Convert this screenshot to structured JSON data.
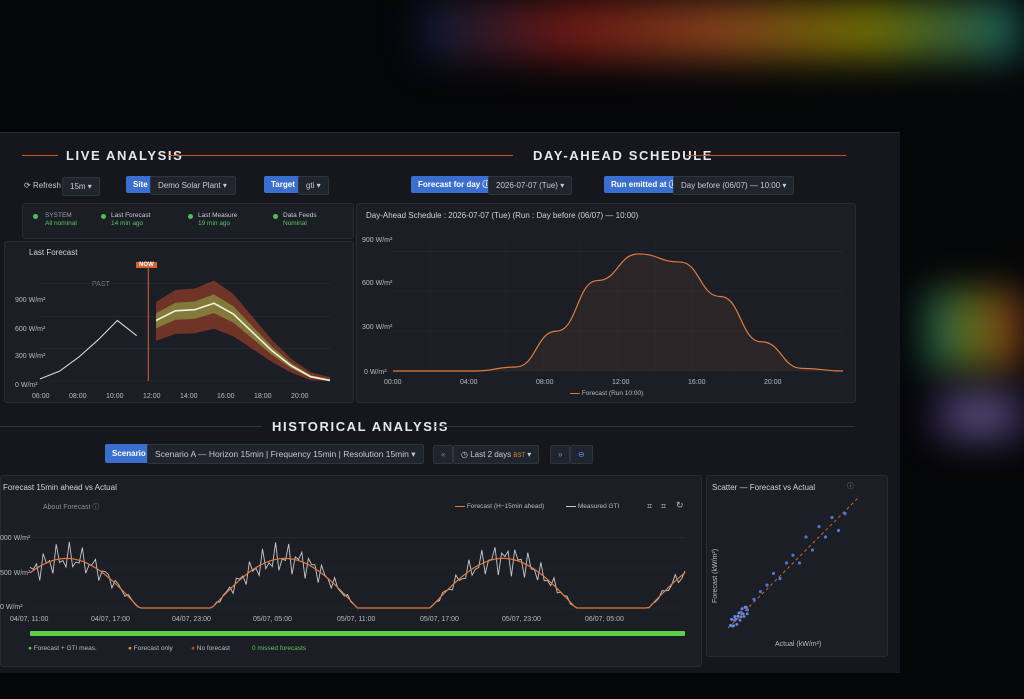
{
  "sections": {
    "live": "LIVE ANALYSIS",
    "dayahead": "DAY-AHEAD SCHEDULE",
    "historical": "HISTORICAL ANALYSIS"
  },
  "toolbar": {
    "refresh_label": "Refresh",
    "refresh_value": "15m",
    "site_label": "Site",
    "site_value": "Demo Solar Plant",
    "target_label": "Target",
    "target_value": "gti",
    "forecast_day_label": "Forecast for day",
    "forecast_day_value": "2026-07-07 (Tue)",
    "run_label": "Run emitted at",
    "run_value": "Day before (06/07) — 10:00"
  },
  "status": {
    "system_label": "SYSTEM",
    "system_value": "All nominal",
    "last_forecast_label": "Last Forecast",
    "last_forecast_value": "14 min ago",
    "last_measure_label": "Last Measure",
    "last_measure_value": "19 min ago",
    "feeds_label": "Data Feeds",
    "feeds_value": "Nominal"
  },
  "live_chart": {
    "title": "Last Forecast",
    "past_label": "PAST",
    "now_label": "NOW",
    "y_ticks": [
      "900 W/m²",
      "600 W/m²",
      "300 W/m²",
      "0 W/m²"
    ],
    "x_ticks": [
      "06:00",
      "08:00",
      "10:00",
      "12:00",
      "14:00",
      "16:00",
      "18:00",
      "20:00"
    ]
  },
  "dayahead_chart": {
    "title": "Day-Ahead Schedule : 2026-07-07 (Tue) (Run : Day before (06/07) — 10:00)",
    "y_ticks": [
      "900 W/m²",
      "600 W/m²",
      "300 W/m²",
      "0 W/m²"
    ],
    "x_ticks": [
      "00:00",
      "04:00",
      "08:00",
      "12:00",
      "16:00",
      "20:00"
    ],
    "legend": "Forecast (Run 10:00)"
  },
  "historical": {
    "scenario_label": "Scenario",
    "scenario_value": "Scenario A — Horizon 15min | Frequency 15min | Resolution 15min",
    "range_value": "Last 2 days",
    "tz": "BST"
  },
  "hist_chart": {
    "title": "Forecast 15min ahead vs Actual",
    "about": "About Forecast",
    "legend_forecast": "Forecast (H−15min ahead)",
    "legend_measured": "Measured GTI",
    "y_ticks": [
      "000 W/m²",
      "500 W/m²",
      "0 W/m²"
    ],
    "x_ticks": [
      "04/07, 11:00",
      "04/07, 17:00",
      "04/07, 23:00",
      "05/07, 05:00",
      "05/07, 11:00",
      "05/07, 17:00",
      "05/07, 23:00",
      "06/07, 05:00"
    ],
    "legend_both": "Forecast + GTI meas.",
    "legend_fc_only": "Forecast only",
    "legend_none": "No forecast",
    "missed": "0 missed forecasts"
  },
  "scatter": {
    "title": "Scatter — Forecast vs Actual",
    "xlabel": "Actual (kW/m²)",
    "ylabel": "Forecast (kW/m²)"
  },
  "chart_data": [
    {
      "type": "line",
      "title": "Last Forecast",
      "x": [
        "06:00",
        "07:00",
        "08:00",
        "09:00",
        "10:00",
        "10:30",
        "11:00",
        "12:00",
        "13:00",
        "14:00",
        "15:00",
        "16:00",
        "17:00",
        "18:00",
        "19:00",
        "20:00"
      ],
      "series": [
        {
          "name": "measured",
          "values": [
            20,
            90,
            220,
            380,
            560,
            420,
            null,
            null,
            null,
            null,
            null,
            null,
            null,
            null,
            null,
            null
          ]
        },
        {
          "name": "forecast",
          "values": [
            null,
            null,
            null,
            null,
            null,
            null,
            560,
            650,
            660,
            720,
            620,
            450,
            280,
            140,
            40,
            5
          ]
        }
      ],
      "ylim": [
        0,
        1000
      ]
    },
    {
      "type": "line",
      "title": "Day-Ahead Schedule : 2026-07-07 (Tue) (Run : Day before (06/07) — 10:00)",
      "x": [
        "00:00",
        "02:00",
        "04:00",
        "06:00",
        "08:00",
        "10:00",
        "12:00",
        "14:00",
        "16:00",
        "18:00",
        "20:00",
        "22:00"
      ],
      "series": [
        {
          "name": "Forecast (Run 10:00)",
          "values": [
            0,
            0,
            0,
            30,
            300,
            680,
            880,
            820,
            560,
            220,
            20,
            0
          ]
        }
      ],
      "ylim": [
        0,
        1000
      ]
    },
    {
      "type": "scatter",
      "title": "Scatter — Forecast vs Actual",
      "xlabel": "Actual (kW/m²)",
      "ylabel": "Forecast (kW/m²)",
      "x": [
        0.05,
        0.1,
        0.15,
        0.2,
        0.25,
        0.3,
        0.35,
        0.4,
        0.45,
        0.5,
        0.55,
        0.6,
        0.65,
        0.7,
        0.75,
        0.8,
        0.85,
        0.9
      ],
      "y": [
        0.06,
        0.12,
        0.14,
        0.22,
        0.28,
        0.33,
        0.42,
        0.38,
        0.5,
        0.56,
        0.5,
        0.7,
        0.6,
        0.78,
        0.7,
        0.85,
        0.75,
        0.88
      ]
    }
  ]
}
